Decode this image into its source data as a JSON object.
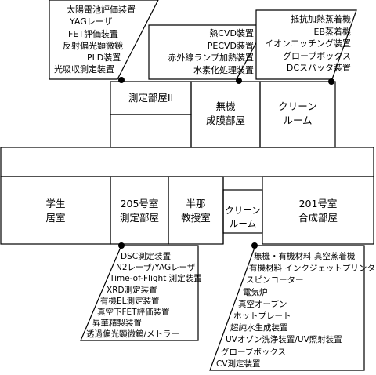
{
  "rooms": {
    "measurement_2": {
      "line1": "測定部屋II"
    },
    "inorganic_film": {
      "line1": "無機",
      "line2": "成膜部屋"
    },
    "clean_room_upper": {
      "line1": "クリーン",
      "line2": "ルーム"
    },
    "student_room": {
      "line1": "学生",
      "line2": "居室"
    },
    "room_205": {
      "line1": "205号室",
      "line2": "測定部屋"
    },
    "associate_prof": {
      "line1": "半那",
      "line2": "教授室"
    },
    "clean_room_lower": {
      "line1": "クリーン",
      "line2": "ルーム"
    },
    "room_201": {
      "line1": "201号室",
      "line2": "合成部屋"
    }
  },
  "equipment": {
    "measurement_2": [
      "太陽電池評価装置",
      "YAGレーザ",
      "FET評価装置",
      "反射偏光顕微鏡",
      "PLD装置",
      "光吸収測定装置"
    ],
    "inorganic_film": [
      "熱CVD装置",
      "PECVD装置",
      "赤外線ランプ加熱装置",
      "水素化処理装置"
    ],
    "clean_room_upper": [
      "抵抗加熱蒸着機",
      "EB蒸着機",
      "イオンエッチング装置",
      "グローブボックス",
      "DCスパッタ装置"
    ],
    "room_205": [
      "DSC測定装置",
      "N2レーザ/YAGレーザ",
      "Time-of-Flight 測定装置",
      "XRD測定装置",
      "有機EL測定装置",
      "真空下FET評価装置",
      "昇華精製装置",
      "透過偏光顕微鏡/メトラー"
    ],
    "clean_room_lower": [
      "無機・有機材料 真空蒸着機",
      "有機材料 インクジェットプリンタ",
      "スピンコーター",
      "電気炉",
      "真空オーブン",
      "ホットプレート",
      "超純水生成装置",
      "UVオゾン洗浄装置/UV照射装置",
      "グローブボックス",
      "CV測定装置"
    ]
  }
}
